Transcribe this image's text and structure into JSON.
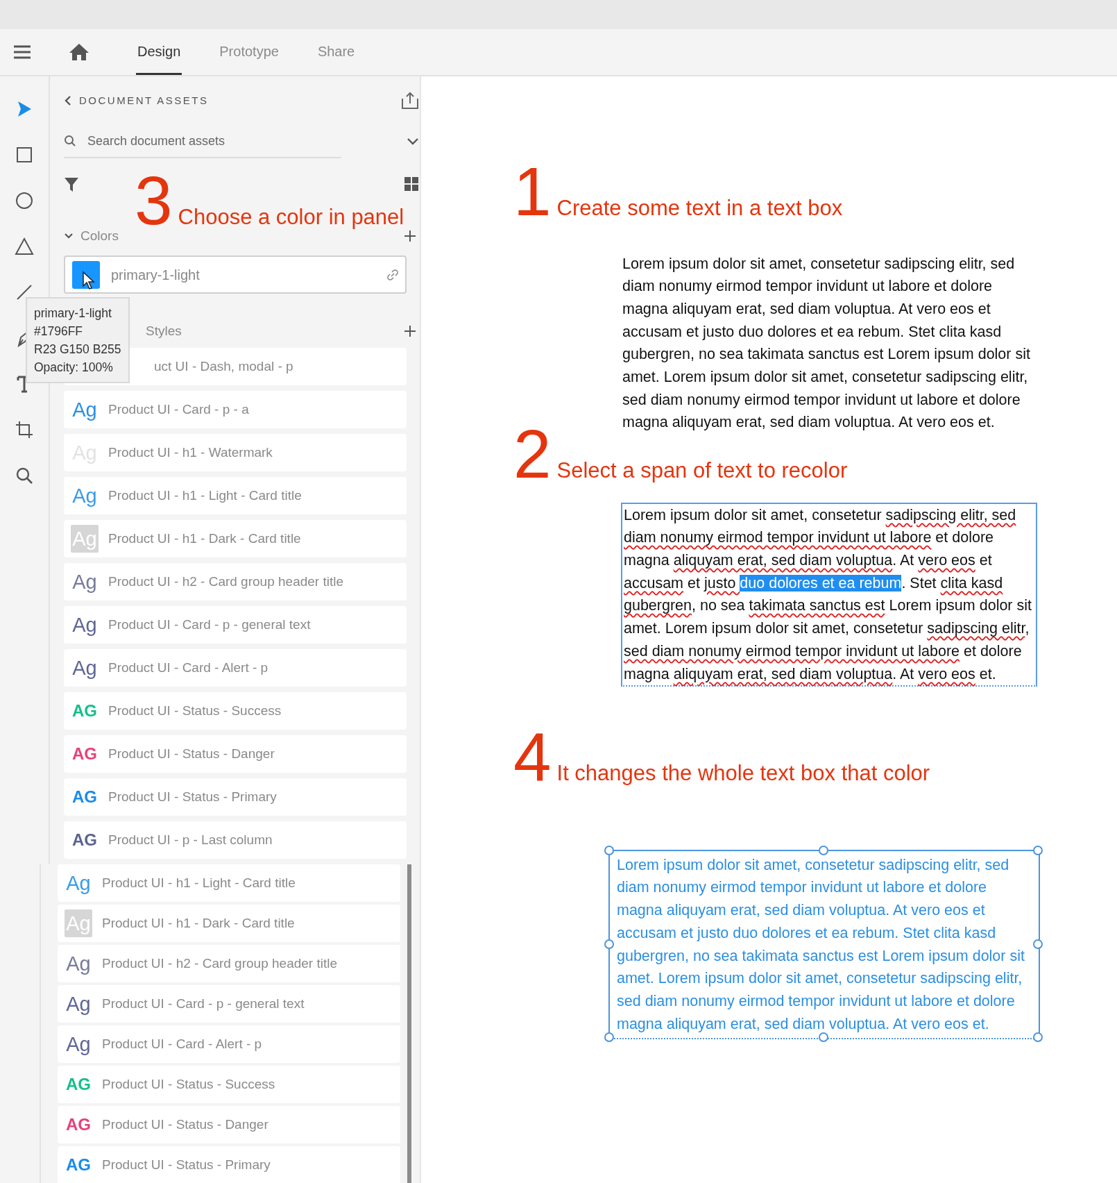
{
  "top_bar": {
    "tabs": [
      {
        "label": "Design",
        "selected": true
      },
      {
        "label": "Prototype",
        "selected": false
      },
      {
        "label": "Share",
        "selected": false
      }
    ]
  },
  "tools": [
    {
      "kind": "select",
      "selected": true
    },
    {
      "kind": "rectangle",
      "selected": false
    },
    {
      "kind": "ellipse",
      "selected": false
    },
    {
      "kind": "triangle",
      "selected": false
    },
    {
      "kind": "line",
      "selected": false
    },
    {
      "kind": "pen",
      "selected": false
    },
    {
      "kind": "text",
      "selected": false
    },
    {
      "kind": "artboard",
      "selected": false
    },
    {
      "kind": "zoom",
      "selected": false
    }
  ],
  "assets_panel": {
    "title": "DOCUMENT ASSETS",
    "search": {
      "placeholder": "Search document assets"
    },
    "annotation": {
      "number": "3",
      "text": "Choose a color in panel"
    },
    "colors_section": {
      "label": "Colors",
      "expanded": true,
      "items": [
        {
          "name": "primary-1-light",
          "color": "#1796ff"
        }
      ]
    },
    "tooltip": {
      "lines": [
        "primary-1-light",
        "#1796FF",
        "R23 G150 B255",
        "Opacity: 100%"
      ]
    },
    "styles_section": {
      "label": "Styles",
      "items": [
        {
          "kind": "covered",
          "label": "uct UI - Dash, modal - p"
        },
        {
          "kind": "regular",
          "swatch": "Ag",
          "color": "#2a90e6",
          "label": "Product UI - Card - p - a"
        },
        {
          "kind": "regular",
          "swatch": "Ag",
          "color": "#e2e2e2",
          "label": "Product UI - h1 - Watermark"
        },
        {
          "kind": "regular",
          "swatch": "Ag",
          "color": "#3a9ce8",
          "label": "Product UI - h1 - Light - Card title"
        },
        {
          "kind": "tile",
          "swatch": "Ag",
          "color": "#d6d6d6",
          "label": "Product UI - h1 - Dark - Card title"
        },
        {
          "kind": "regular",
          "swatch": "Ag",
          "color": "#767b9e",
          "label": "Product UI - h2 - Card group header title"
        },
        {
          "kind": "regular",
          "swatch": "Ag",
          "color": "#5f6696",
          "label": "Product UI - Card - p - general text"
        },
        {
          "kind": "regular",
          "swatch": "Ag",
          "color": "#5f6696",
          "label": "Product UI - Card - Alert - p"
        },
        {
          "kind": "bold",
          "swatch": "AG",
          "color": "#14c08a",
          "label": "Product UI - Status - Success"
        },
        {
          "kind": "bold",
          "swatch": "AG",
          "color": "#e8407a",
          "label": "Product UI - Status - Danger"
        },
        {
          "kind": "bold",
          "swatch": "AG",
          "color": "#1b8be8",
          "label": "Product UI - Status - Primary"
        },
        {
          "kind": "bold",
          "swatch": "AG",
          "color": "#5c6390",
          "label": "Product UI - p - Last column"
        }
      ]
    }
  },
  "overlaid_panel": {
    "items": [
      {
        "kind": "regular",
        "swatch": "Ag",
        "color": "#3a9ce8",
        "label": "Product UI - h1 - Light - Card title"
      },
      {
        "kind": "tile",
        "swatch": "Ag",
        "color": "#d6d6d6",
        "label": "Product UI - h1 - Dark - Card title"
      },
      {
        "kind": "regular",
        "swatch": "Ag",
        "color": "#767b9e",
        "label": "Product UI - h2 - Card group header title"
      },
      {
        "kind": "regular",
        "swatch": "Ag",
        "color": "#5f6696",
        "label": "Product UI - Card - p - general text"
      },
      {
        "kind": "regular",
        "swatch": "Ag",
        "color": "#5f6696",
        "label": "Product UI - Card - Alert - p"
      },
      {
        "kind": "bold",
        "swatch": "AG",
        "color": "#14c08a",
        "label": "Product UI - Status - Success"
      },
      {
        "kind": "bold",
        "swatch": "AG",
        "color": "#e8407a",
        "label": "Product UI - Status - Danger"
      },
      {
        "kind": "bold",
        "swatch": "AG",
        "color": "#1b8be8",
        "label": "Product UI - Status - Primary"
      }
    ]
  },
  "canvas": {
    "steps": [
      {
        "number": "1",
        "caption": "Create some text in a text box",
        "kind": "plain",
        "text": "Lorem ipsum dolor sit amet, consetetur sadipscing elitr, sed diam nonumy eirmod tempor invidunt ut labore et dolore magna aliquyam erat, sed diam voluptua. At vero eos et accusam et justo duo dolores et ea rebum. Stet clita kasd gubergren, no sea takimata sanctus est Lorem ipsum dolor sit amet. Lorem ipsum dolor sit amet, consetetur sadipscing elitr, sed diam nonumy eirmod tempor invidunt ut labore et dolore magna aliquyam erat, sed diam voluptua. At vero eos et."
      },
      {
        "number": "2",
        "caption": "Select a span of text to recolor",
        "kind": "editing",
        "segments": [
          {
            "text": "Lorem ipsum dolor sit amet, consetetur ",
            "misspelled": false,
            "selected": false
          },
          {
            "text": "sadipscing elitr, sed diam nonumy eirmod tempor invidunt ut labore",
            "misspelled": true,
            "selected": false
          },
          {
            "text": " et dolore magna ",
            "misspelled": false,
            "selected": false
          },
          {
            "text": "aliquyam erat, sed diam voluptua",
            "misspelled": true,
            "selected": false
          },
          {
            "text": ". At ",
            "misspelled": false,
            "selected": false
          },
          {
            "text": "vero eos",
            "misspelled": true,
            "selected": false
          },
          {
            "text": " et ",
            "misspelled": false,
            "selected": false
          },
          {
            "text": "accusam",
            "misspelled": true,
            "selected": false
          },
          {
            "text": " et ",
            "misspelled": false,
            "selected": false
          },
          {
            "text": "justo ",
            "misspelled": true,
            "selected": false
          },
          {
            "text": "duo dolores et ea rebum",
            "misspelled": false,
            "selected": true
          },
          {
            "text": ". Stet ",
            "misspelled": false,
            "selected": false
          },
          {
            "text": "clita kasd gubergren",
            "misspelled": true,
            "selected": false
          },
          {
            "text": ", no sea ",
            "misspelled": false,
            "selected": false
          },
          {
            "text": "takimata sanctus est",
            "misspelled": true,
            "selected": false
          },
          {
            "text": " Lorem ipsum dolor sit amet. Lorem ipsum dolor sit amet, consetetur ",
            "misspelled": false,
            "selected": false
          },
          {
            "text": "sadipscing elitr",
            "misspelled": true,
            "selected": false
          },
          {
            "text": ", ",
            "misspelled": false,
            "selected": false
          },
          {
            "text": "sed diam nonumy eirmod tempor invidunt ut labore",
            "misspelled": true,
            "selected": false
          },
          {
            "text": " et dolore magna ",
            "misspelled": false,
            "selected": false
          },
          {
            "text": "aliquyam erat, sed diam voluptua",
            "misspelled": true,
            "selected": false
          },
          {
            "text": ". At ",
            "misspelled": false,
            "selected": false
          },
          {
            "text": "vero eos",
            "misspelled": true,
            "selected": false
          },
          {
            "text": " et.",
            "misspelled": false,
            "selected": false
          }
        ]
      },
      {
        "number": "4",
        "caption": "It changes the whole text box that color",
        "kind": "selected",
        "text": "Lorem ipsum dolor sit amet, consetetur sadipscing elitr, sed diam nonumy eirmod tempor invidunt ut labore et dolore magna aliquyam erat, sed diam voluptua. At vero eos et accusam et justo duo dolores et ea rebum. Stet clita kasd gubergren, no sea takimata sanctus est Lorem ipsum dolor sit amet. Lorem ipsum dolor sit amet, consetetur sadipscing elitr, sed diam nonumy eirmod tempor invidunt ut labore et dolore magna aliquyam erat, sed diam voluptua. At vero eos et."
      }
    ]
  }
}
